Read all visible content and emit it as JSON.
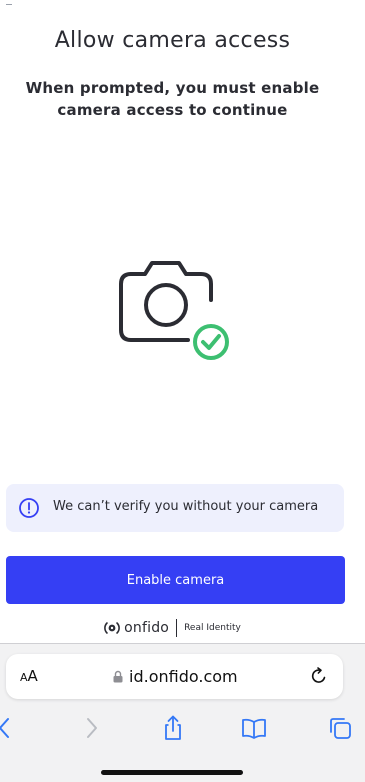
{
  "page": {
    "title": "Allow camera access",
    "subtitle_line1": "When prompted, you must enable",
    "subtitle_line2": "camera access to continue"
  },
  "illustration": {
    "icon": "camera-icon",
    "badge_icon": "check-circle-icon",
    "badge_color": "#3dbf71"
  },
  "info_banner": {
    "icon": "info-icon",
    "text": "We can’t verify you without your camera"
  },
  "enable_button": {
    "label": "Enable camera",
    "color": "#353ff4"
  },
  "brand": {
    "name": "onfido",
    "tagline": "Real Identity"
  },
  "browser": {
    "text_size_label_small": "A",
    "text_size_label_large": "A",
    "url": "id.onfido.com",
    "icons": [
      "lock-icon",
      "reload-icon",
      "back-icon",
      "forward-icon",
      "share-icon",
      "bookmarks-icon",
      "tabs-icon"
    ]
  }
}
